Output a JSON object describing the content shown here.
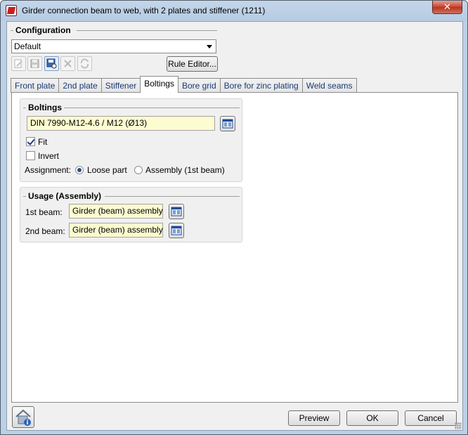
{
  "window": {
    "title": "Girder connection beam to web, with 2 plates and stiffener (1211)",
    "close_label": "✕",
    "icon": "hicad-app-icon"
  },
  "configuration": {
    "caption": "Configuration",
    "selected": "Default",
    "rule_editor_label": "Rule Editor...",
    "toolbar_icons": [
      "edit-icon",
      "save-icon",
      "save-as-icon",
      "delete-icon",
      "refresh-icon"
    ]
  },
  "tabs": [
    {
      "label": "Front plate",
      "active": false
    },
    {
      "label": "2nd plate",
      "active": false
    },
    {
      "label": "Stiffener",
      "active": false
    },
    {
      "label": "Boltings",
      "active": true
    },
    {
      "label": "Bore grid",
      "active": false
    },
    {
      "label": "Bore for zinc plating",
      "active": false
    },
    {
      "label": "Weld seams",
      "active": false
    }
  ],
  "boltings": {
    "caption": "Boltings",
    "bolt_value": "DIN 7990-M12-4.6 / M12 (Ø13)",
    "fit_label": "Fit",
    "fit_checked": true,
    "invert_label": "Invert",
    "invert_checked": false,
    "assignment_label": "Assignment:",
    "loose_part_label": "Loose part",
    "assembly_label": "Assembly (1st beam)",
    "assignment_selected": "Loose part"
  },
  "usage": {
    "caption": "Usage (Assembly)",
    "first_beam_label": "1st beam:",
    "first_beam_value": "Girder (beam) assembly",
    "second_beam_label": "2nd beam:",
    "second_beam_value": "Girder (beam) assembly"
  },
  "buttons": {
    "preview": "Preview",
    "ok": "OK",
    "cancel": "Cancel"
  },
  "colors": {
    "field_background": "#fdfbd0",
    "window_frame": "#bcd0e6",
    "close_button": "#c7432f"
  }
}
